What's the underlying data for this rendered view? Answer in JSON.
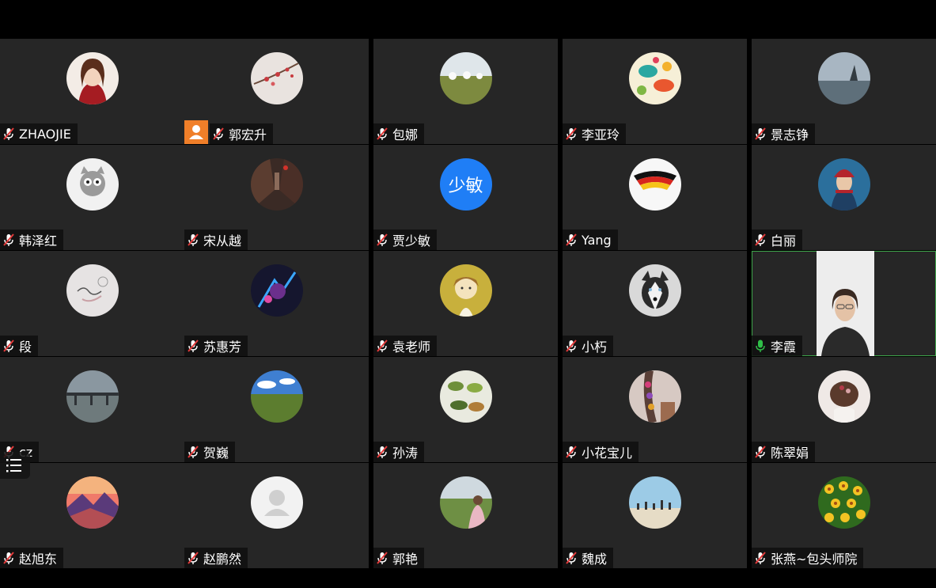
{
  "meeting": {
    "participants": [
      {
        "name": "ZHAOJIE",
        "avatar": "girl-avatar",
        "mic": "muted"
      },
      {
        "name": "郭宏升",
        "avatar": "plum-blossom-avatar",
        "mic": "muted",
        "host": true
      },
      {
        "name": "包娜",
        "avatar": "grassland-yurts-avatar",
        "mic": "muted"
      },
      {
        "name": "李亚玲",
        "avatar": "fish-pattern-avatar",
        "mic": "muted"
      },
      {
        "name": "景志铮",
        "avatar": "lake-rock-avatar",
        "mic": "muted"
      },
      {
        "name": "韩泽红",
        "avatar": "cartoon-cat-avatar",
        "mic": "muted"
      },
      {
        "name": "宋从越",
        "avatar": "alley-avatar",
        "mic": "muted"
      },
      {
        "name": "贾少敏",
        "avatar_text": "少敏",
        "mic": "muted"
      },
      {
        "name": "Yang",
        "avatar": "flag-avatar",
        "mic": "muted"
      },
      {
        "name": "白丽",
        "avatar": "ethnic-woman-avatar",
        "mic": "muted"
      },
      {
        "name": "段",
        "avatar": "sketch-2015-avatar",
        "mic": "muted"
      },
      {
        "name": "苏惠芳",
        "avatar": "fantasy-art-avatar",
        "mic": "muted"
      },
      {
        "name": "袁老师",
        "avatar": "girl-illustration-avatar",
        "mic": "muted"
      },
      {
        "name": "小朽",
        "avatar": "husky-dog-avatar",
        "mic": "muted"
      },
      {
        "name": "李霞",
        "video": true,
        "mic": "active"
      },
      {
        "name": "cz",
        "avatar": "bridge-avatar",
        "mic": "muted"
      },
      {
        "name": "贺巍",
        "avatar": "meadow-sky-avatar",
        "mic": "muted"
      },
      {
        "name": "孙涛",
        "avatar": "leaves-avatar",
        "mic": "muted"
      },
      {
        "name": "小花宝儿",
        "avatar": "flower-braid-avatar",
        "mic": "muted"
      },
      {
        "name": "陈翠娟",
        "avatar": "hair-flower-avatar",
        "mic": "muted"
      },
      {
        "name": "赵旭东",
        "avatar": "mountain-sunset-avatar",
        "mic": "muted"
      },
      {
        "name": "赵鹏然",
        "avatar": "default-user-avatar",
        "mic": "muted"
      },
      {
        "name": "郭艳",
        "avatar": "grassland-child-avatar",
        "mic": "muted"
      },
      {
        "name": "魏成",
        "avatar": "beach-people-avatar",
        "mic": "muted"
      },
      {
        "name": "张燕~包头师院",
        "avatar": "yellow-flowers-avatar",
        "mic": "muted"
      }
    ],
    "colors": {
      "tile": "#262626",
      "muted_icon": "#ffffff",
      "active_mic": "#2fbf48",
      "host_badge": "#f07f29",
      "avatar_text_bg": "#1f7ef6"
    }
  }
}
